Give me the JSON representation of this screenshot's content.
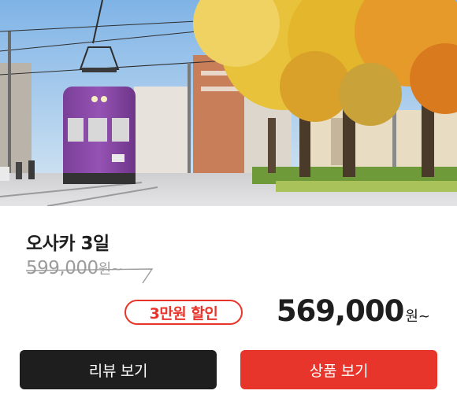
{
  "product": {
    "title": "오사카 3일",
    "original_price": "599,000",
    "original_unit": "원~",
    "discount_badge": "3만원 할인",
    "price": "569,000",
    "price_unit": "원~"
  },
  "buttons": {
    "review_label": "리뷰 보기",
    "product_label": "상품 보기"
  },
  "colors": {
    "accent": "#e8352b",
    "dark": "#1e1e1e",
    "muted": "#9c9c9c"
  }
}
